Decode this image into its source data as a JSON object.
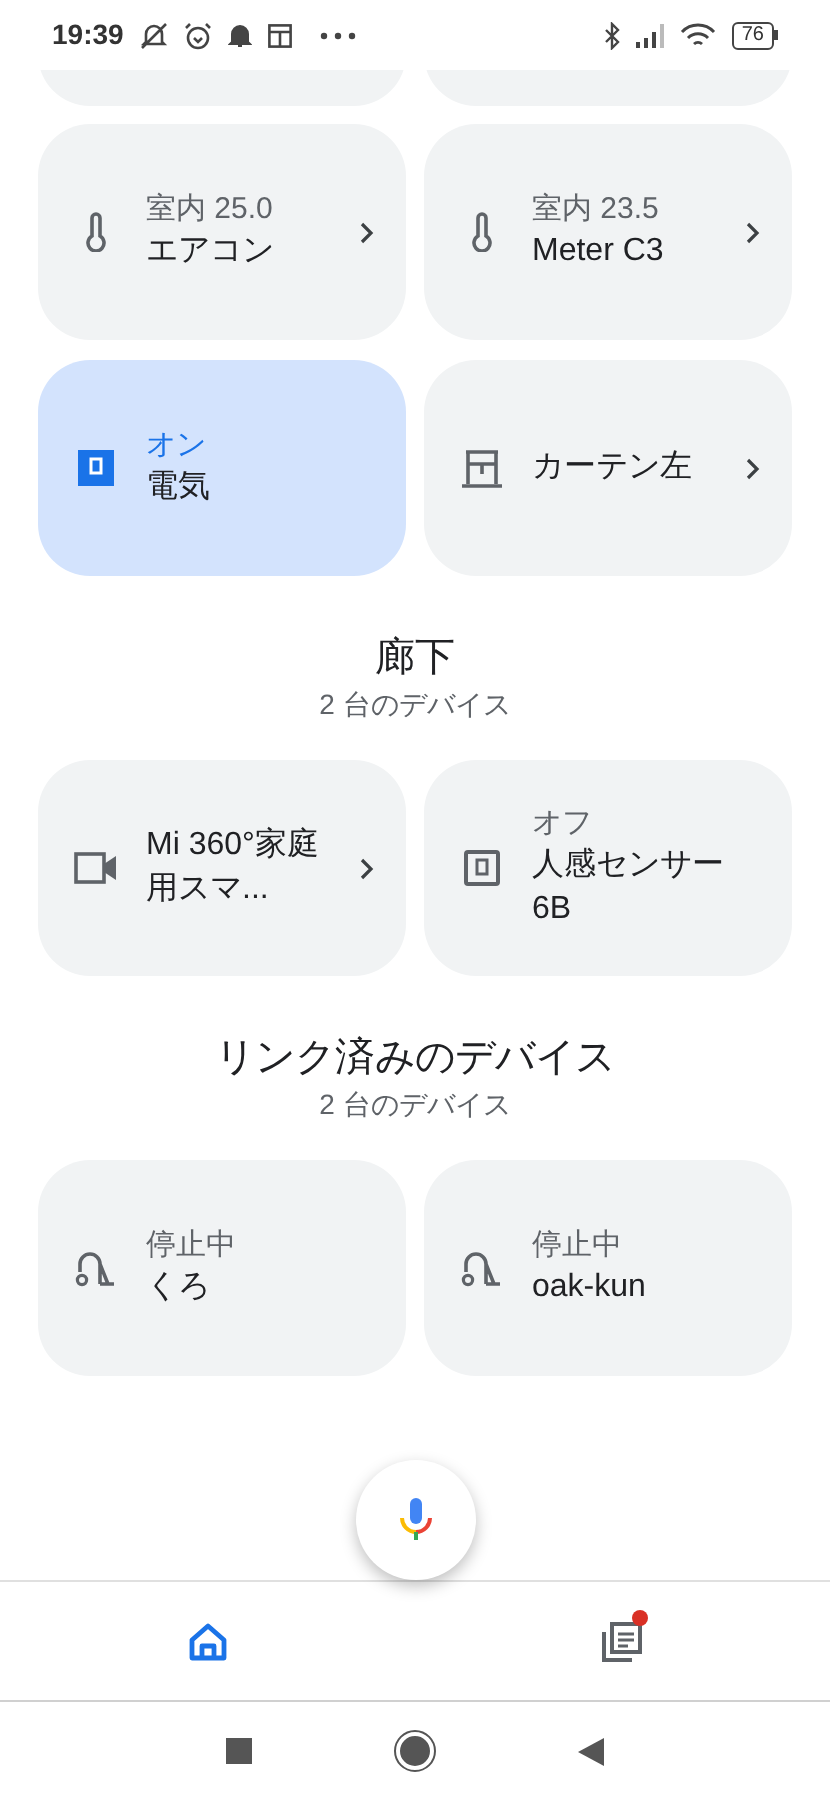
{
  "status_bar": {
    "time": "19:39",
    "battery": "76"
  },
  "sections": [
    {
      "tiles": [
        {
          "kind": "thermometer",
          "status": "室内 25.0",
          "name": "エアコン",
          "on": false,
          "has_detail": true
        },
        {
          "kind": "thermometer",
          "status": "室内 23.5",
          "name": "Meter C3",
          "on": false,
          "has_detail": true
        },
        {
          "kind": "switch",
          "status": "オン",
          "name": "電気",
          "on": true,
          "has_detail": false
        },
        {
          "kind": "curtain",
          "name": "カーテン左",
          "on": false,
          "has_detail": true
        }
      ]
    },
    {
      "title": "廊下",
      "subtitle": "2 台のデバイス",
      "tiles": [
        {
          "kind": "camera",
          "name": "Mi 360°家庭用スマ...",
          "on": false,
          "has_detail": true
        },
        {
          "kind": "sensor",
          "status": "オフ",
          "name": "人感センサー6B",
          "on": false,
          "has_detail": false
        }
      ]
    },
    {
      "title": "リンク済みのデバイス",
      "subtitle": "2 台のデバイス",
      "tiles": [
        {
          "kind": "vacuum",
          "status": "停止中",
          "name": "くろ",
          "on": false,
          "has_detail": false
        },
        {
          "kind": "vacuum",
          "status": "停止中",
          "name": "oak-kun",
          "on": false,
          "has_detail": false
        }
      ]
    }
  ],
  "bottom_nav": [
    {
      "kind": "home",
      "selected": true
    },
    {
      "kind": "feed",
      "selected": false,
      "badge": true
    }
  ]
}
